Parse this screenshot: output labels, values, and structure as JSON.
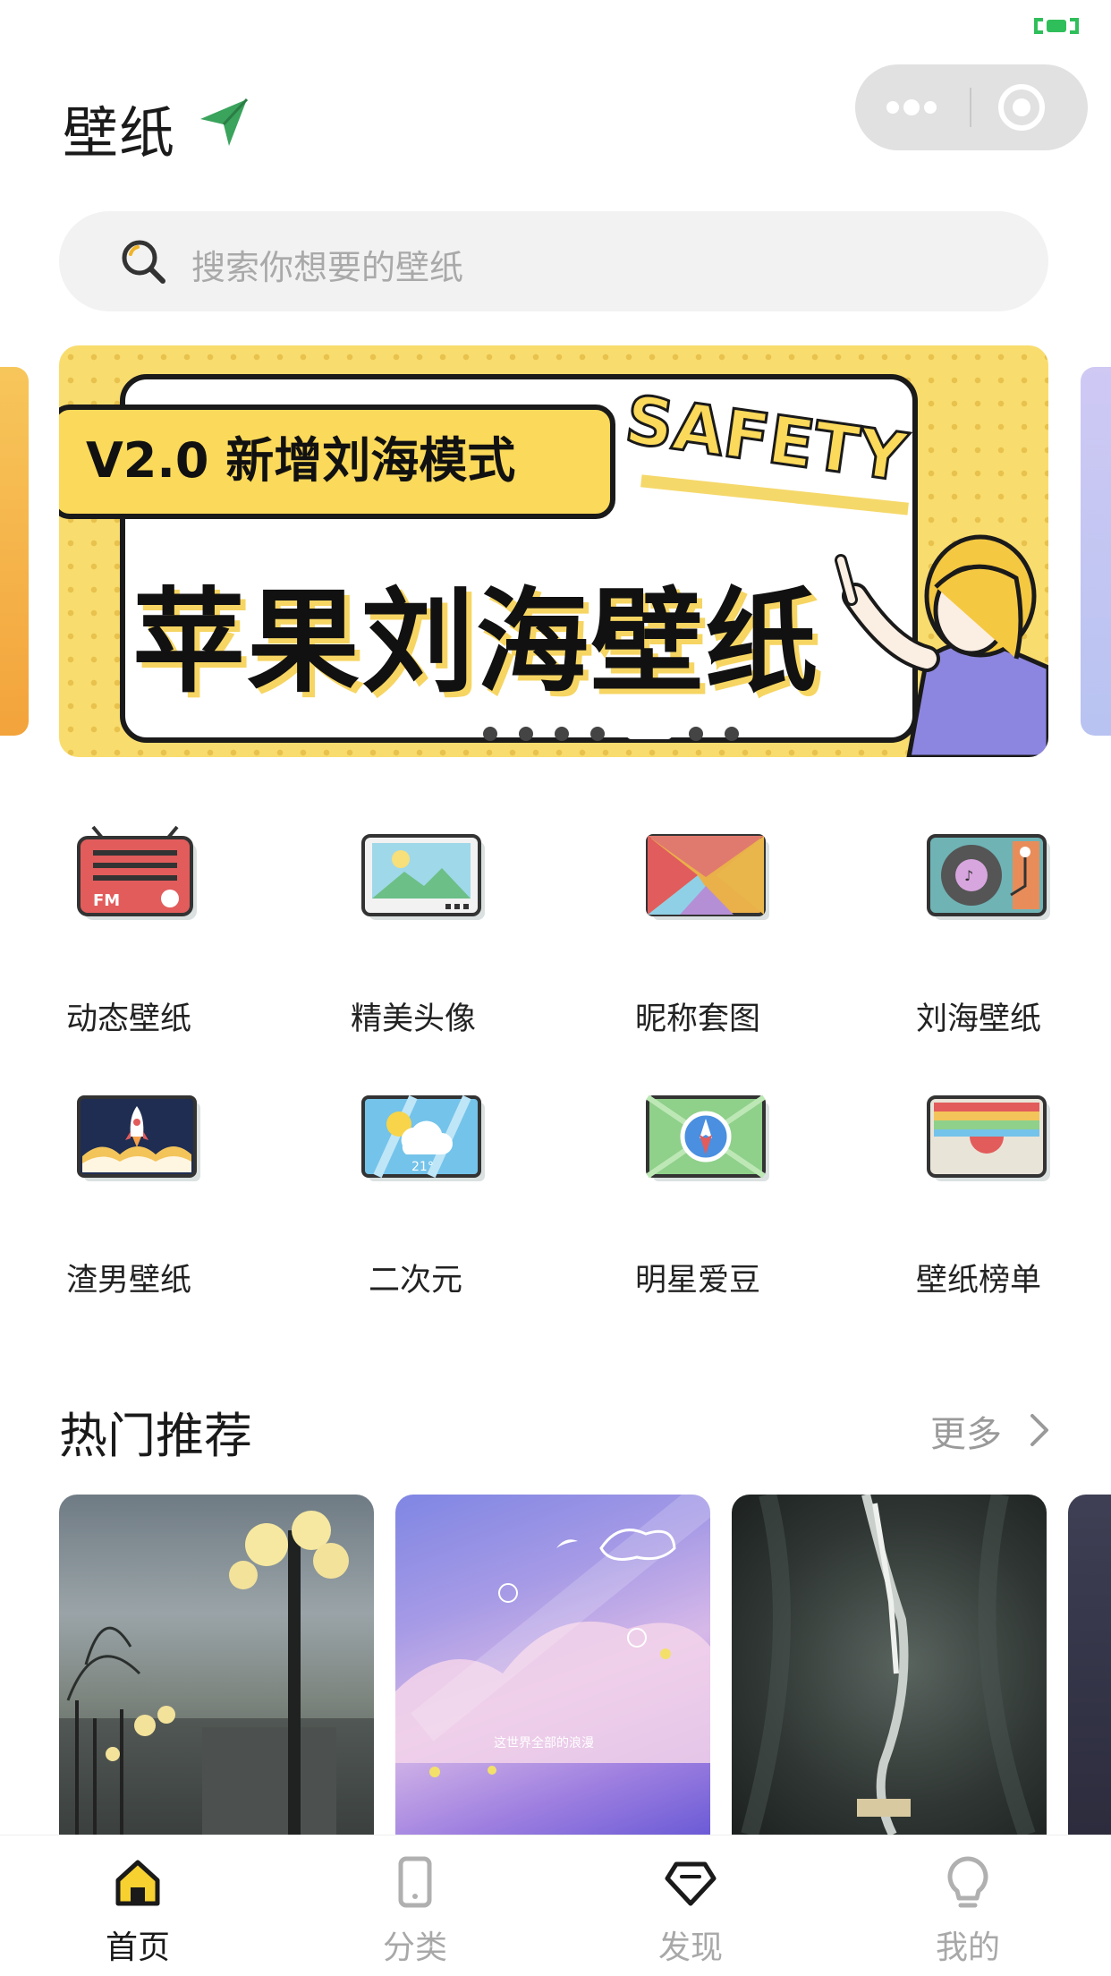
{
  "header": {
    "title": "壁纸",
    "send_icon": "send-icon",
    "capsule": {
      "more_icon": "more-dots-icon",
      "close_icon": "target-icon"
    }
  },
  "search": {
    "placeholder": "搜索你想要的壁纸",
    "icon": "search-icon"
  },
  "banner": {
    "subtitle": "V2.0 新增刘海模式",
    "badge": "SAFETY",
    "title": "苹果刘海壁纸",
    "page_count": 7,
    "active_index": 4
  },
  "categories": [
    {
      "label": "动态壁纸",
      "icon": "radio-icon",
      "icon_text": "FM"
    },
    {
      "label": "精美头像",
      "icon": "picture-frame-icon"
    },
    {
      "label": "昵称套图",
      "icon": "envelope-icon"
    },
    {
      "label": "刘海壁纸",
      "icon": "record-player-icon"
    },
    {
      "label": "渣男壁纸",
      "icon": "rocket-icon"
    },
    {
      "label": "二次元",
      "icon": "weather-icon",
      "icon_text": "21°"
    },
    {
      "label": "明星爱豆",
      "icon": "compass-icon"
    },
    {
      "label": "壁纸榜单",
      "icon": "wallet-icon"
    }
  ],
  "recommend": {
    "title": "热门推荐",
    "more": "更多",
    "items": [
      {
        "name": "street-lamps-thumbnail"
      },
      {
        "name": "purple-sky-thumbnail",
        "caption": "这世界全部的浪漫"
      },
      {
        "name": "aerial-train-thumbnail"
      }
    ]
  },
  "tabbar": {
    "items": [
      {
        "label": "首页",
        "icon": "home-icon",
        "active": true
      },
      {
        "label": "分类",
        "icon": "phone-icon",
        "active": false
      },
      {
        "label": "发现",
        "icon": "diamond-icon",
        "active": false
      },
      {
        "label": "我的",
        "icon": "bulb-icon",
        "active": false
      }
    ]
  },
  "colors": {
    "accent_green": "#3aa35c",
    "banner_yellow": "#f8dc6e",
    "tab_active": "#1a1a1a",
    "tab_inactive": "#a8a8a8"
  }
}
